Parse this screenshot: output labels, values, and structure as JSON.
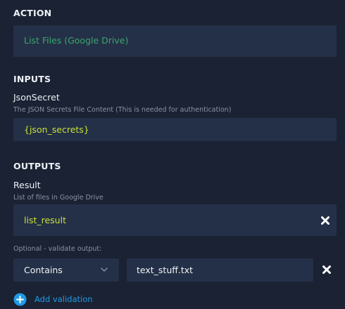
{
  "action": {
    "header": "ACTION",
    "value": "List Files (Google Drive)"
  },
  "inputs": {
    "header": "INPUTS",
    "fields": [
      {
        "label": "JsonSecret",
        "description": "The JSON Secrets File Content (This is needed for authentication)",
        "value": "{json_secrets}"
      }
    ]
  },
  "outputs": {
    "header": "OUTPUTS",
    "fields": [
      {
        "label": "Result",
        "description": "List of files in Google Drive",
        "value": "list_result"
      }
    ],
    "validation": {
      "label": "Optional - validate output:",
      "operator": "Contains",
      "value": "text_stuff.txt",
      "add_label": "Add validation"
    }
  },
  "colors": {
    "background": "#1a2233",
    "field_background": "#243047",
    "action_text": "#3aa66a",
    "variable_text": "#c7e03a",
    "accent_blue": "#1e9be6"
  },
  "icons": {
    "remove_output": "close-icon",
    "remove_validation": "close-icon",
    "operator_dropdown": "chevron-down-icon",
    "add_validation": "plus-circle-icon"
  }
}
